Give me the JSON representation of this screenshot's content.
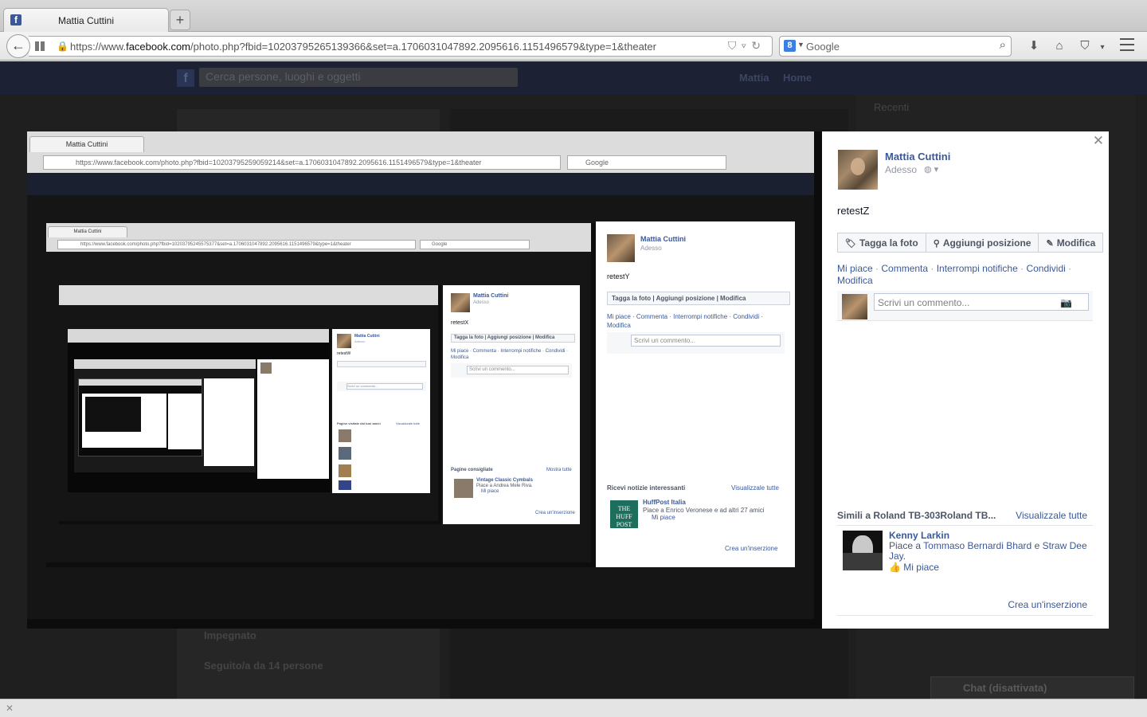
{
  "browser": {
    "tab_title": "Mattia Cuttini",
    "favicon": "f",
    "new_tab": "+",
    "url_prefix": "https://www.",
    "url_domain": "facebook.com",
    "url_rest": "/photo.php?fbid=10203795265139366&set=a.1706031047892.2095616.1151496579&type=1&theater",
    "search_engine": "Google",
    "search_logo": "8"
  },
  "background_page": {
    "search_placeholder": "Cerca persone, luoghi e oggetti",
    "user": "Mattia",
    "home": "Home",
    "recent": "Recenti",
    "impegnato": "Impegnato",
    "seguito": "Seguito/a da 14 persone",
    "chat": "Chat (disattivata)"
  },
  "sidebar": {
    "author": "Mattia Cuttini",
    "time": "Adesso",
    "caption": "retestZ",
    "actions": {
      "tag": "Tagga la foto",
      "location": "Aggiungi posizione",
      "edit": "Modifica"
    },
    "links": {
      "like": "Mi piace",
      "comment": "Commenta",
      "stop": "Interrompi notifiche",
      "share": "Condividi",
      "edit": "Modifica"
    },
    "comment_placeholder": "Scrivi un commento...",
    "suggestions": {
      "title": "Simili a Roland TB-303Roland TB...",
      "see_all": "Visualizzale tutte",
      "name": "Kenny Larkin",
      "likes_prefix": "Piace a",
      "friend1": "Tommaso Bernardi Bhard",
      "and": "e",
      "friend2": "Straw Dee Jay.",
      "like": "Mi piace"
    },
    "create_ad": "Crea un'inserzione"
  },
  "nested1": {
    "tab_title": "Mattia Cuttini",
    "url": "https://www.facebook.com/photo.php?fbid=10203795259059214&set=a.1706031047892.2095616.1151496579&type=1&theater",
    "search": "Google",
    "author": "Mattia Cuttini",
    "time": "Adesso",
    "caption": "retestY",
    "buttons": "Tagga la foto  |  Aggiungi posizione  |  Modifica",
    "links": "Mi piace · Commenta · Interrompi notifiche · Condividi · Modifica",
    "comment": "Scrivi un commento...",
    "news_title": "Ricevi notizie interessanti",
    "news_all": "Visualizzale tutte",
    "huff_name": "HuffPost Italia",
    "huff_line": "Piace a Enrico Veronese e ad altri 27 amici",
    "huff_like": "Mi piace",
    "huff_logo": "THE HUFF POST",
    "create_ad": "Crea un'inserzione"
  },
  "nested2": {
    "tab_title": "Mattia Cuttini",
    "url": "https://www.facebook.com/photo.php?fbid=10203795245575377&set=a.1706031047892.2095616.1151496579&type=1&theater",
    "search": "Google",
    "author": "Mattia Cuttini",
    "time": "Adesso",
    "caption": "retestX",
    "buttons": "Tagga la foto | Aggiungi posizione | Modifica",
    "links": "Mi piace · Commenta · Interrompi notifiche · Condividi · Modifica",
    "comment": "Scrivi un commento...",
    "pages_title": "Pagine consigliate",
    "pages_all": "Mostra tutte",
    "page_name": "Vintage Classic Cymbals",
    "page_line": "Piace a Andrea Mele Riva.",
    "page_like": "Mi piace",
    "create_ad": "Crea un'inserzione"
  },
  "nested3": {
    "author": "Mattia Cuttini",
    "time": "Adesso",
    "caption": "retestW",
    "comment": "Scrivi un commento...",
    "friends_title": "Pagine visitate dai tuoi amici",
    "friends_all": "Visualizzale tutte"
  }
}
